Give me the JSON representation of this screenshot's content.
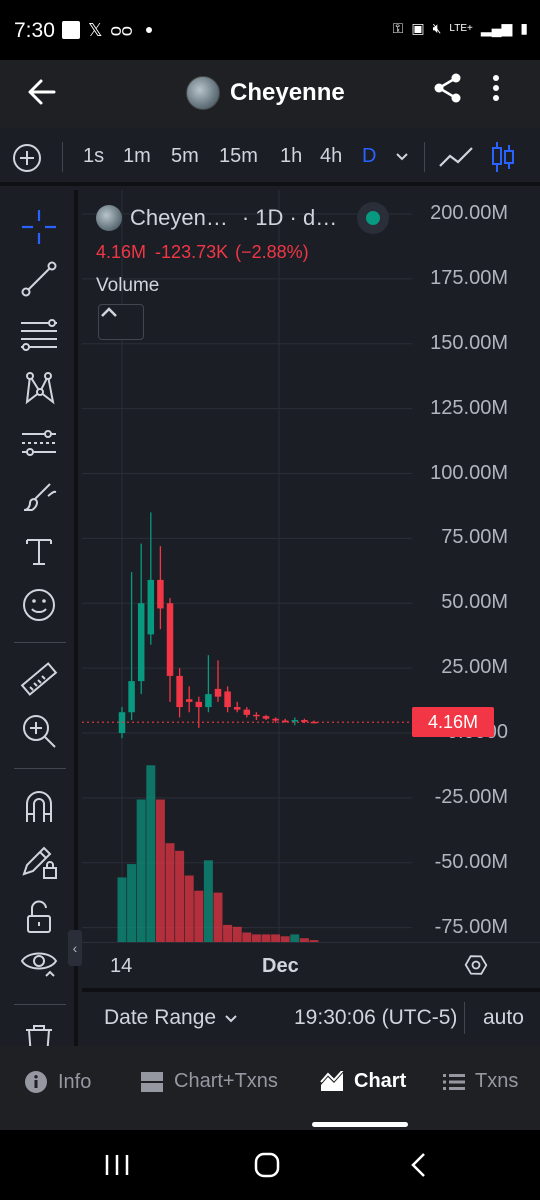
{
  "status_bar": {
    "time": "7:30",
    "left_icons": [
      "square-icon",
      "x-logo-icon",
      "voicemail-icon"
    ],
    "right_icons": [
      "key-icon",
      "battery-saver-icon",
      "mute-icon",
      "lte-signal-icon",
      "signal-bars-icon",
      "battery-icon"
    ],
    "lte": "LTE+"
  },
  "header": {
    "title": "Cheyenne",
    "back_icon": "arrow-left-icon",
    "share_icon": "share-icon",
    "more_icon": "more-vertical-icon"
  },
  "timeframes": {
    "items": [
      "1s",
      "1m",
      "5m",
      "15m",
      "1h",
      "4h",
      "D"
    ],
    "active": "D"
  },
  "legend": {
    "symbol": "Cheyen…",
    "details": "· 1D · d…",
    "value": "4.16M",
    "change": "-123.73K",
    "change_pct": "(−2.88%)",
    "indicator": "Volume"
  },
  "y_axis": {
    "labels": [
      "200.00M",
      "175.00M",
      "150.00M",
      "125.00M",
      "100.00M",
      "75.00M",
      "50.00M",
      "25.00M",
      "0.0000",
      "-25.00M",
      "-50.00M",
      "-75.00M"
    ],
    "last_price_tag": "4.16M"
  },
  "x_axis": {
    "labels": [
      "14",
      "Dec"
    ]
  },
  "bottom_bar": {
    "date_range": "Date Range",
    "clock": "19:30:06 (UTC-5)",
    "scale": "auto"
  },
  "bottom_nav": {
    "items": [
      {
        "label": "Info",
        "icon": "info-icon"
      },
      {
        "label": "Chart+Txns",
        "icon": "chart-txns-icon"
      },
      {
        "label": "Chart",
        "icon": "area-chart-icon"
      },
      {
        "label": "Txns",
        "icon": "list-icon"
      }
    ],
    "active": "Chart"
  },
  "colors": {
    "up": "#089981",
    "down": "#f23645",
    "background": "#1b1e25",
    "accent": "#2962ff"
  },
  "chart_data": {
    "type": "candlestick",
    "interval": "1D",
    "price_unit": "M",
    "ylim": [
      -85,
      205
    ],
    "candles": [
      {
        "o": 0,
        "h": 10,
        "l": -2,
        "c": 8,
        "dir": "up"
      },
      {
        "o": 8,
        "h": 62,
        "l": 5,
        "c": 20,
        "dir": "up"
      },
      {
        "o": 20,
        "h": 73,
        "l": 15,
        "c": 50,
        "dir": "up"
      },
      {
        "o": 38,
        "h": 85,
        "l": 34,
        "c": 59,
        "dir": "up"
      },
      {
        "o": 59,
        "h": 72,
        "l": 40,
        "c": 48,
        "dir": "down"
      },
      {
        "o": 50,
        "h": 52,
        "l": 12,
        "c": 22,
        "dir": "down"
      },
      {
        "o": 22,
        "h": 25,
        "l": 6,
        "c": 10,
        "dir": "down"
      },
      {
        "o": 13,
        "h": 18,
        "l": 8,
        "c": 12,
        "dir": "down"
      },
      {
        "o": 12,
        "h": 14,
        "l": 2,
        "c": 10,
        "dir": "down"
      },
      {
        "o": 10,
        "h": 30,
        "l": 8,
        "c": 15,
        "dir": "up"
      },
      {
        "o": 17,
        "h": 28,
        "l": 12,
        "c": 14,
        "dir": "down"
      },
      {
        "o": 16,
        "h": 18,
        "l": 8,
        "c": 10,
        "dir": "down"
      },
      {
        "o": 10,
        "h": 12,
        "l": 8,
        "c": 9,
        "dir": "down"
      },
      {
        "o": 9,
        "h": 10,
        "l": 6,
        "c": 7,
        "dir": "down"
      },
      {
        "o": 7,
        "h": 8,
        "l": 5,
        "c": 6.5,
        "dir": "down"
      },
      {
        "o": 6.5,
        "h": 7,
        "l": 5,
        "c": 5.5,
        "dir": "down"
      },
      {
        "o": 5.5,
        "h": 6,
        "l": 4,
        "c": 4.8,
        "dir": "down"
      },
      {
        "o": 4.8,
        "h": 5.5,
        "l": 4,
        "c": 4.5,
        "dir": "down"
      },
      {
        "o": 4.5,
        "h": 6,
        "l": 3,
        "c": 5,
        "dir": "up"
      },
      {
        "o": 5,
        "h": 5.5,
        "l": 3.8,
        "c": 4.3,
        "dir": "down"
      },
      {
        "o": 4.3,
        "h": 4.8,
        "l": 3.9,
        "c": 4.16,
        "dir": "down"
      }
    ],
    "volume": [
      0.34,
      0.41,
      0.75,
      0.93,
      0.75,
      0.52,
      0.48,
      0.35,
      0.27,
      0.43,
      0.26,
      0.09,
      0.08,
      0.05,
      0.04,
      0.04,
      0.04,
      0.03,
      0.04,
      0.02,
      0.01
    ],
    "last_price": 4.16
  }
}
